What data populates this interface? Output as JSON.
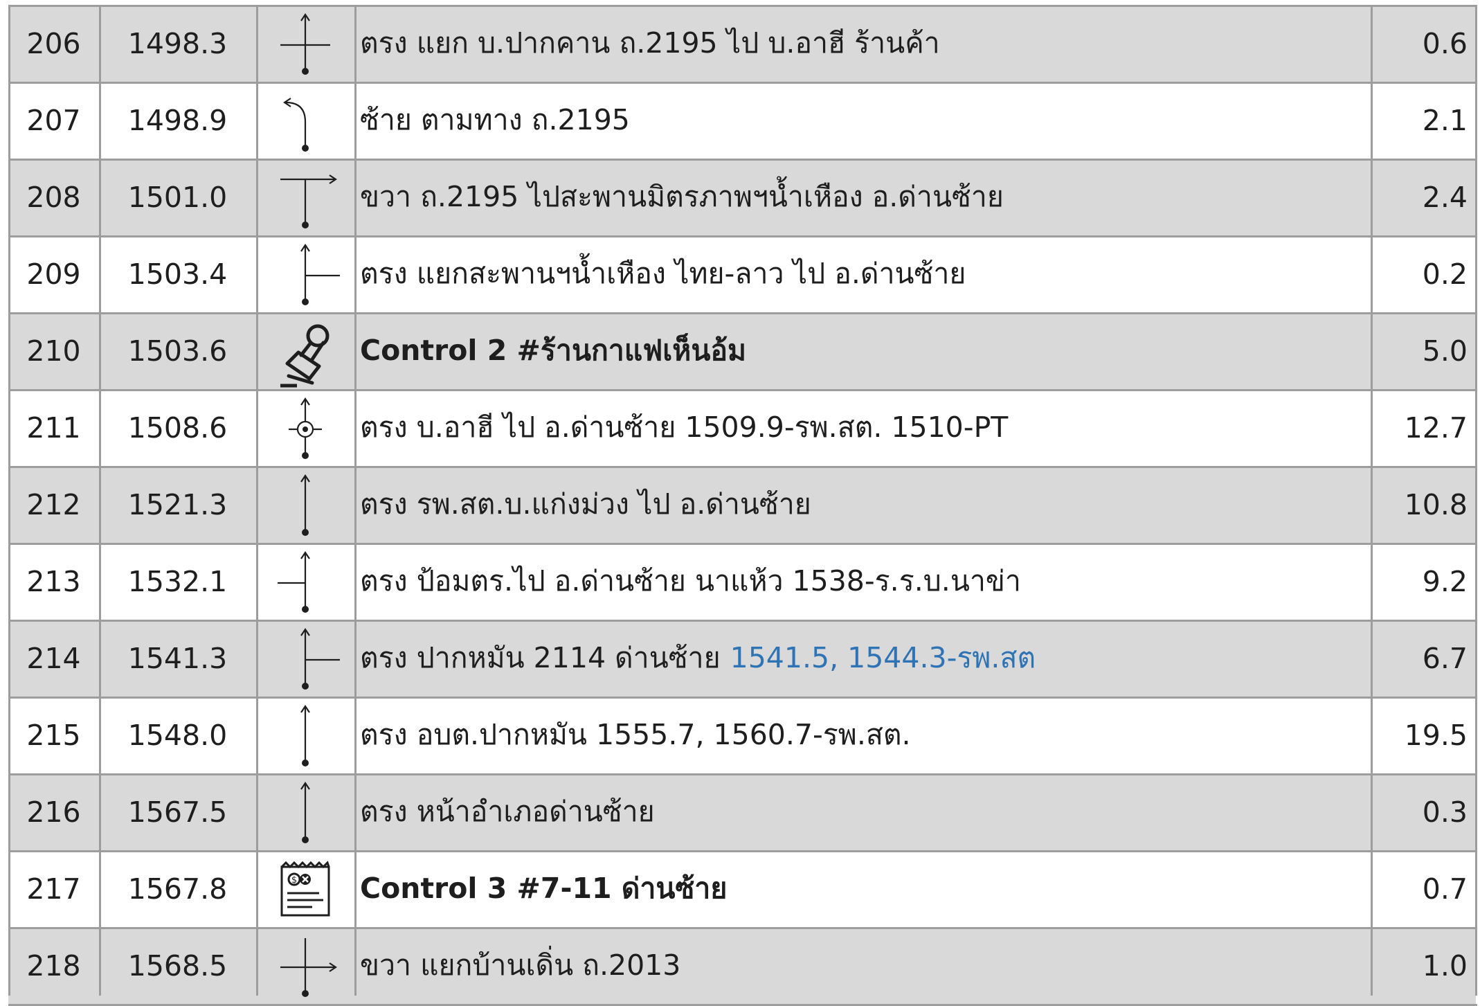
{
  "colors": {
    "shaded_row": "#d9d9d9",
    "grid": "#9d9d9d",
    "text": "#1e1e1e",
    "link_blue": "#2e74b5"
  },
  "rows": [
    {
      "no": "206",
      "km": "1498.3",
      "icon": "crossroad-straight-icon",
      "desc": "ตรง แยก บ.ปากคาน ถ.2195 ไป บ.อาฮี ร้านค้า",
      "extra": "",
      "bold": false,
      "dist": "0.6",
      "shaded": true
    },
    {
      "no": "207",
      "km": "1498.9",
      "icon": "bear-left-icon",
      "desc": "ซ้าย ตามทาง ถ.2195",
      "extra": "",
      "bold": false,
      "dist": "2.1",
      "shaded": false
    },
    {
      "no": "208",
      "km": "1501.0",
      "icon": "t-junction-right-icon",
      "desc": "ขวา ถ.2195 ไปสะพานมิตรภาพฯน้ำเหือง อ.ด่านซ้าย",
      "extra": "",
      "bold": false,
      "dist": "2.4",
      "shaded": true
    },
    {
      "no": "209",
      "km": "1503.4",
      "icon": "straight-junction-right-icon",
      "desc": "ตรง แยกสะพานฯน้ำเหือง ไทย-ลาว ไป อ.ด่านซ้าย",
      "extra": "",
      "bold": false,
      "dist": "0.2",
      "shaded": false
    },
    {
      "no": "210",
      "km": "1503.6",
      "icon": "stamp-icon",
      "desc": "Control 2 #ร้านกาแฟเห็นอ้ม",
      "extra": "",
      "bold": true,
      "dist": "5.0",
      "shaded": true
    },
    {
      "no": "211",
      "km": "1508.6",
      "icon": "straight-circle-icon",
      "desc": "ตรง บ.อาฮี ไป อ.ด่านซ้าย 1509.9-รพ.สต. 1510-PT",
      "extra": "",
      "bold": false,
      "dist": "12.7",
      "shaded": false
    },
    {
      "no": "212",
      "km": "1521.3",
      "icon": "straight-arrow-icon",
      "desc": "ตรง รพ.สต.บ.แก่งม่วง ไป อ.ด่านซ้าย",
      "extra": "",
      "bold": false,
      "dist": "10.8",
      "shaded": true
    },
    {
      "no": "213",
      "km": "1532.1",
      "icon": "straight-junction-left-icon",
      "desc": "ตรง ป้อมตร.ไป อ.ด่านซ้าย นาแห้ว 1538-ร.ร.บ.นาข่า",
      "extra": "",
      "bold": false,
      "dist": "9.2",
      "shaded": false
    },
    {
      "no": "214",
      "km": "1541.3",
      "icon": "straight-junction-right-icon",
      "desc": "ตรง ปากหมัน 2114 ด่านซ้าย",
      "extra": "1541.5, 1544.3-รพ.สต",
      "bold": false,
      "dist": "6.7",
      "shaded": true
    },
    {
      "no": "215",
      "km": "1548.0",
      "icon": "straight-arrow-icon",
      "desc": "ตรง อบต.ปากหมัน 1555.7, 1560.7-รพ.สต.",
      "extra": "",
      "bold": false,
      "dist": "19.5",
      "shaded": false
    },
    {
      "no": "216",
      "km": "1567.5",
      "icon": "straight-arrow-icon",
      "desc": "ตรง หน้าอำเภอด่านซ้าย",
      "extra": "",
      "bold": false,
      "dist": "0.3",
      "shaded": true
    },
    {
      "no": "217",
      "km": "1567.8",
      "icon": "receipt-icon",
      "desc": "Control 3 #7-11 ด่านซ้าย",
      "extra": "",
      "bold": true,
      "dist": "0.7",
      "shaded": false
    },
    {
      "no": "218",
      "km": "1568.5",
      "icon": "crossroad-right-icon",
      "desc": "ขวา แยกบ้านเดิ่น ถ.2013",
      "extra": "",
      "bold": false,
      "dist": "1.0",
      "shaded": true
    }
  ]
}
